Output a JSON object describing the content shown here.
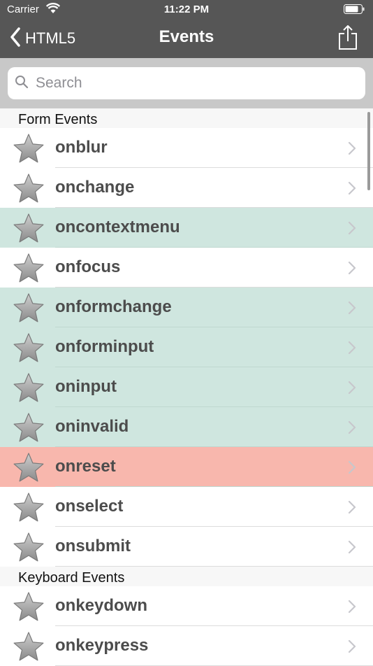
{
  "status": {
    "carrier": "Carrier",
    "time": "11:22 PM"
  },
  "nav": {
    "back_label": "HTML5",
    "title": "Events"
  },
  "search": {
    "placeholder": "Search"
  },
  "colors": {
    "bar": "#565656",
    "highlight_green": "#cfe6df",
    "highlight_red": "#f8b7ad"
  },
  "sections": [
    {
      "title": "Form Events",
      "items": [
        {
          "label": "onblur",
          "state": "normal"
        },
        {
          "label": "onchange",
          "state": "normal"
        },
        {
          "label": "oncontextmenu",
          "state": "green"
        },
        {
          "label": "onfocus",
          "state": "normal"
        },
        {
          "label": "onformchange",
          "state": "green"
        },
        {
          "label": "onforminput",
          "state": "green"
        },
        {
          "label": "oninput",
          "state": "green"
        },
        {
          "label": "oninvalid",
          "state": "green"
        },
        {
          "label": "onreset",
          "state": "red"
        },
        {
          "label": "onselect",
          "state": "normal"
        },
        {
          "label": "onsubmit",
          "state": "normal"
        }
      ]
    },
    {
      "title": "Keyboard Events",
      "items": [
        {
          "label": "onkeydown",
          "state": "normal"
        },
        {
          "label": "onkeypress",
          "state": "normal"
        }
      ]
    }
  ]
}
